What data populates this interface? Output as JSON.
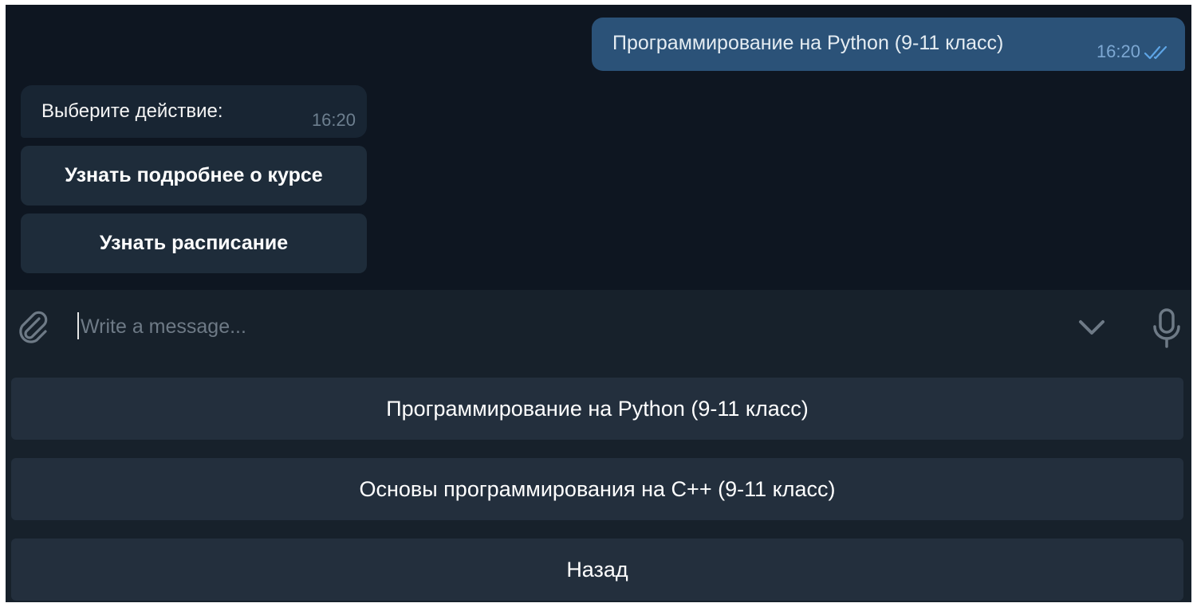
{
  "chat": {
    "outgoing": {
      "text": "Программирование на Python (9-11 класс)",
      "time": "16:20",
      "status_icon": "double-check-icon"
    },
    "incoming": {
      "text": "Выберите действие:",
      "time": "16:20"
    },
    "inline_buttons": [
      "Узнать подробнее о курсе",
      "Узнать расписание"
    ]
  },
  "composer": {
    "placeholder": "Write a message...",
    "icons": [
      "paperclip-icon",
      "chevron-down-icon",
      "microphone-icon"
    ]
  },
  "keyboard": {
    "buttons": [
      "Программирование на Python (9-11 класс)",
      "Основы программирования на С++ (9-11 класс)",
      "Назад"
    ]
  },
  "colors": {
    "chat_bg": "#0e1621",
    "outgoing_bubble": "#2b5278",
    "incoming_bubble": "#182533",
    "panel_bg": "#17212b",
    "keyboard_button": "#232f3d",
    "tick_color": "#5ea5e6"
  }
}
